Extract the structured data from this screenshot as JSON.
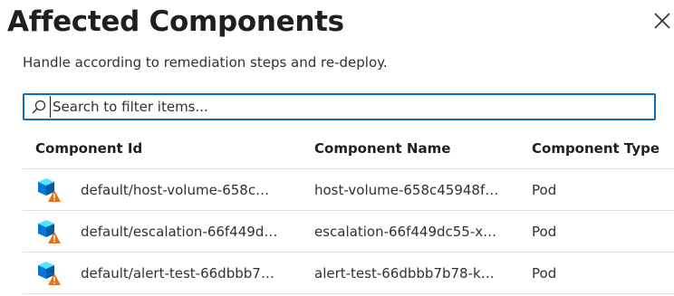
{
  "dialog": {
    "title": "Affected Components",
    "subtitle": "Handle according to remediation steps and re-deploy.",
    "close_icon": "close-icon"
  },
  "search": {
    "placeholder": "Search to filter items...",
    "value": "",
    "icon": "search-icon"
  },
  "table": {
    "columns": [
      "Component Id",
      "Component Name",
      "Component Type"
    ],
    "rows": [
      {
        "id": "default/host-volume-658c…",
        "name": "host-volume-658c45948f…",
        "type": "Pod",
        "icon": "pod-warning-icon"
      },
      {
        "id": "default/escalation-66f449d…",
        "name": "escalation-66f449dc55-x…",
        "type": "Pod",
        "icon": "pod-warning-icon"
      },
      {
        "id": "default/alert-test-66dbbb7…",
        "name": "alert-test-66dbbb7b78-k…",
        "type": "Pod",
        "icon": "pod-warning-icon"
      }
    ]
  },
  "colors": {
    "focus_border": "#0f6cbd",
    "cube_light": "#50e6ff",
    "cube_mid": "#0078d4",
    "cube_dark": "#005ba1",
    "warning": "#e8711c"
  }
}
